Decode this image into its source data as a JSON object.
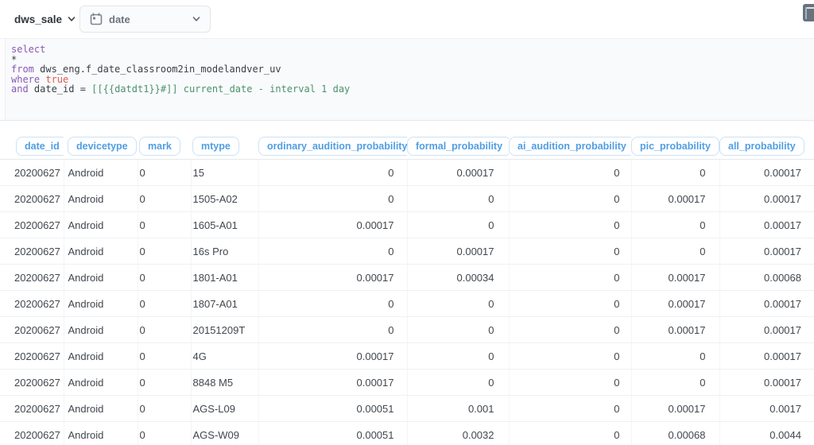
{
  "topbar": {
    "database_label": "dws_sale",
    "filter_widget": {
      "label": "date"
    },
    "icons": {
      "database_chevron": "chevron-down",
      "filter_icon": "calendar",
      "filter_chevron": "chevron-down",
      "corner_icon": "notebook-panel"
    }
  },
  "colors": {
    "brand_blue": "#509ee3",
    "keyword_purple": "#8959b8",
    "literal_red": "#e05a50",
    "variable_teal": "#4d916e",
    "editor_bg": "#f9fafb"
  },
  "sql": {
    "l1_kw": "select",
    "l2_txt": "*",
    "l3_kw": "from",
    "l3_txt": " dws_eng.f_date_classroom2in_modelandver_uv",
    "l4_kw": "where",
    "l4_lit": " true",
    "l5_kw": "and",
    "l5_txt": " date_id = ",
    "l5_var": "[[{{datdt1}}#]] current_date - interval 1 day"
  },
  "table": {
    "columns": [
      "date_id",
      "devicetype",
      "mark",
      "mtype",
      "ordinary_audition_probability",
      "formal_probability",
      "ai_audition_probability",
      "pic_probability",
      "all_probability"
    ],
    "rows": [
      [
        "20200627",
        "Android",
        "0",
        "15",
        "0",
        "0.00017",
        "0",
        "0",
        "0.00017"
      ],
      [
        "20200627",
        "Android",
        "0",
        "1505-A02",
        "0",
        "0",
        "0",
        "0.00017",
        "0.00017"
      ],
      [
        "20200627",
        "Android",
        "0",
        "1605-A01",
        "0.00017",
        "0",
        "0",
        "0",
        "0.00017"
      ],
      [
        "20200627",
        "Android",
        "0",
        "16s Pro",
        "0",
        "0.00017",
        "0",
        "0",
        "0.00017"
      ],
      [
        "20200627",
        "Android",
        "0",
        "1801-A01",
        "0.00017",
        "0.00034",
        "0",
        "0.00017",
        "0.00068"
      ],
      [
        "20200627",
        "Android",
        "0",
        "1807-A01",
        "0",
        "0",
        "0",
        "0.00017",
        "0.00017"
      ],
      [
        "20200627",
        "Android",
        "0",
        "20151209T",
        "0",
        "0",
        "0",
        "0.00017",
        "0.00017"
      ],
      [
        "20200627",
        "Android",
        "0",
        "4G",
        "0.00017",
        "0",
        "0",
        "0",
        "0.00017"
      ],
      [
        "20200627",
        "Android",
        "0",
        "8848 M5",
        "0.00017",
        "0",
        "0",
        "0",
        "0.00017"
      ],
      [
        "20200627",
        "Android",
        "0",
        "AGS-L09",
        "0.00051",
        "0.001",
        "0",
        "0.00017",
        "0.0017"
      ],
      [
        "20200627",
        "Android",
        "0",
        "AGS-W09",
        "0.00051",
        "0.0032",
        "0",
        "0.00068",
        "0.0044"
      ]
    ]
  }
}
